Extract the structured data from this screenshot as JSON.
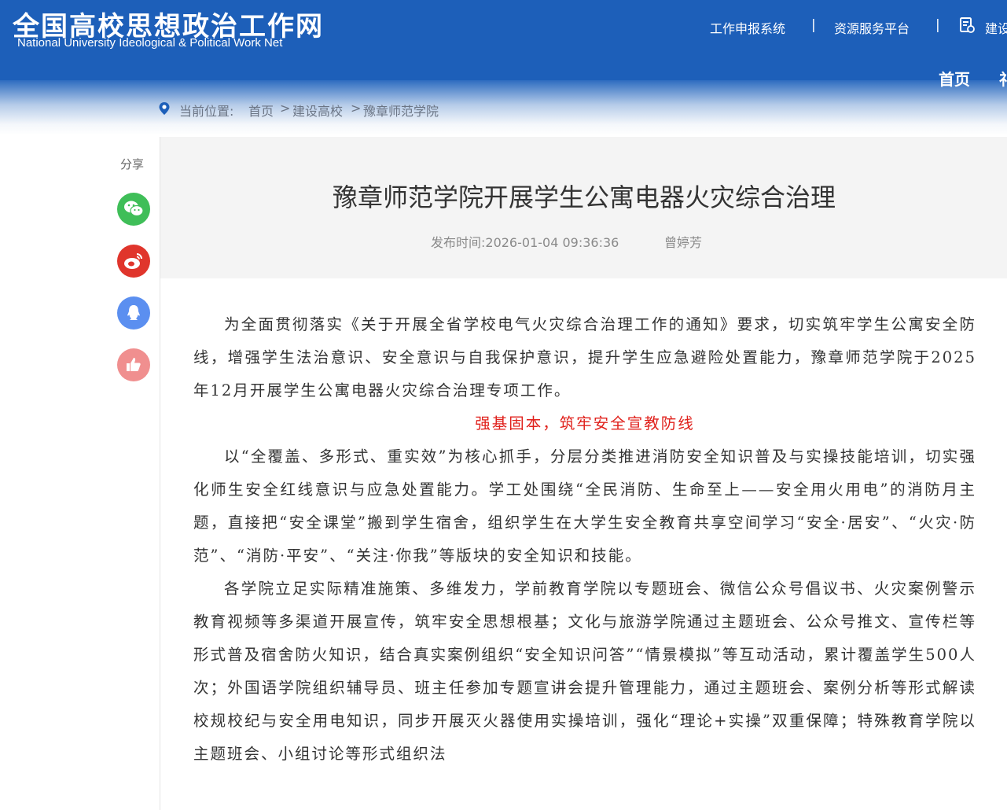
{
  "header": {
    "logo_cn": "全国高校思想政治工作网",
    "logo_en": "National University Ideological & Political Work Net",
    "links": [
      "工作申报系统",
      "资源服务平台",
      "建设"
    ],
    "separator": "|",
    "nav": [
      "首页",
      "礼"
    ],
    "bg_color": "#1d5fb9"
  },
  "breadcrumb": {
    "prefix": "当前位置:",
    "items": [
      "首页",
      "建设高校",
      "豫章师范学院"
    ],
    "arrow": ">"
  },
  "share": {
    "label": "分享",
    "buttons": [
      {
        "icon": "wechat-icon",
        "color": "#3fbe58"
      },
      {
        "icon": "weibo-icon",
        "color": "#e0352c"
      },
      {
        "icon": "qq-icon",
        "color": "#5b8ff0"
      },
      {
        "icon": "thumbs-up-icon",
        "color": "#f08f8f"
      }
    ]
  },
  "article": {
    "title": "豫章师范学院开展学生公寓电器火灾综合治理",
    "publish_time": "发布时间:2026-01-04 09:36:36",
    "author": "曾婷芳",
    "paragraphs": [
      "为全面贯彻落实《关于开展全省学校电气火灾综合治理工作的通知》要求，切实筑牢学生公寓安全防线，增强学生法治意识、安全意识与自我保护意识，提升学生应急避险处置能力，豫章师范学院于2025年12月开展学生公寓电器火灾综合治理专项工作。",
      "强基固本，筑牢安全宣教防线",
      "以“全覆盖、多形式、重实效”为核心抓手，分层分类推进消防安全知识普及与实操技能培训，切实强化师生安全红线意识与应急处置能力。学工处围绕“全民消防、生命至上——安全用火用电”的消防月主题，直接把“安全课堂”搬到学生宿舍，组织学生在大学生安全教育共享空间学习“安全·居安”、“火灾·防范”、“消防·平安”、“关注·你我”等版块的安全知识和技能。",
      "各学院立足实际精准施策、多维发力，学前教育学院以专题班会、微信公众号倡议书、火灾案例警示教育视频等多渠道开展宣传，筑牢安全思想根基；文化与旅游学院通过主题班会、公众号推文、宣传栏等形式普及宿舍防火知识，结合真实案例组织“安全知识问答”“情景模拟”等互动活动，累计覆盖学生500人次；外国语学院组织辅导员、班主任参加专题宣讲会提升管理能力，通过主题班会、案例分析等形式解读校规校纪与安全用电知识，同步开展灭火器使用实操培训，强化“理论+实操”双重保障；特殊教育学院以主题班会、小组讨论等形式组织法"
    ],
    "subheading_color": "#e0211c"
  }
}
